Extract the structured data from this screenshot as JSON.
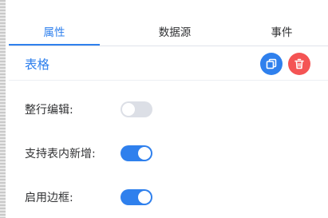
{
  "tabs": [
    {
      "label": "属性",
      "active": true
    },
    {
      "label": "数据源",
      "active": false
    },
    {
      "label": "事件",
      "active": false
    }
  ],
  "section": {
    "title": "表格",
    "copy_icon": "copy-icon",
    "delete_icon": "trash-icon"
  },
  "fields": [
    {
      "label": "整行编辑:",
      "enabled": false
    },
    {
      "label": "支持表内新增:",
      "enabled": true
    },
    {
      "label": "启用边框:",
      "enabled": true
    }
  ],
  "colors": {
    "accent": "#2f80ed",
    "danger": "#f45454",
    "switch_off": "#dcdfe6"
  }
}
